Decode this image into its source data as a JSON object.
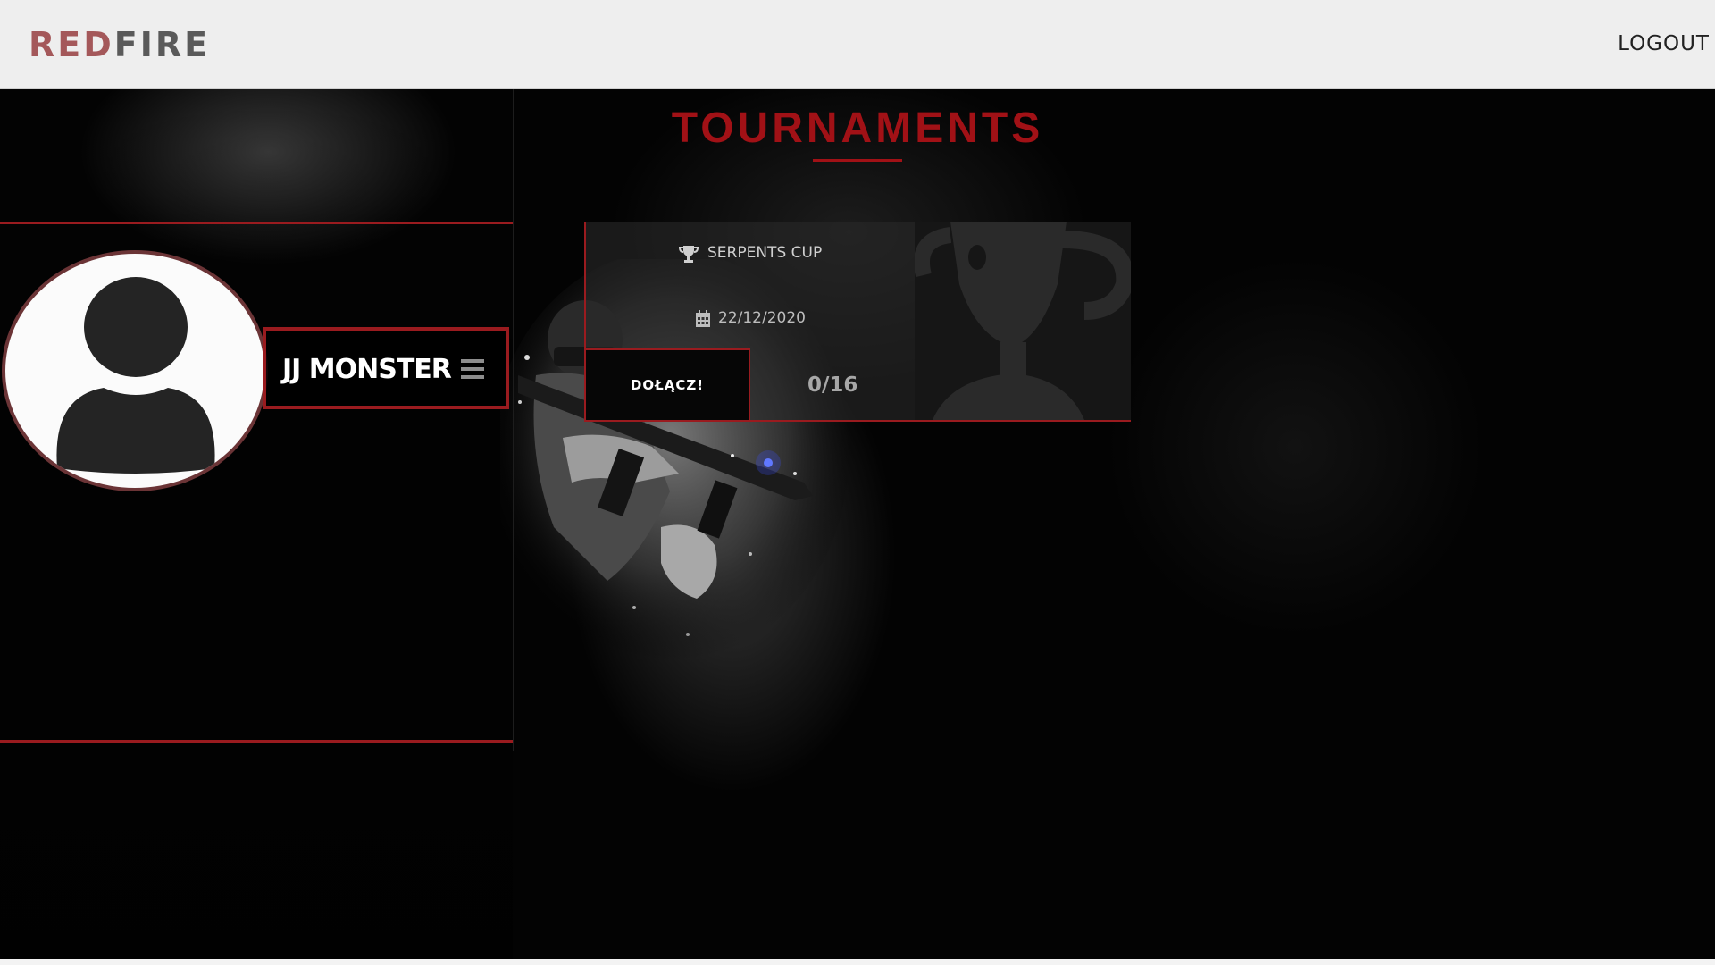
{
  "brand": {
    "part1": "RED",
    "part2": "FIRE"
  },
  "header": {
    "logout_label": "LOGOUT"
  },
  "page": {
    "title": "TOURNAMENTS"
  },
  "profile": {
    "username": "JJ MONSTER"
  },
  "tournament": {
    "name": "SERPENTS CUP",
    "date": "22/12/2020",
    "join_label": "DOŁĄCZ!",
    "slots": "0/16"
  },
  "colors": {
    "accent": "#9a1b1f",
    "title": "#a11116",
    "logo_red": "#a4585a",
    "logo_gray": "#5a5a5a",
    "topbar": "#eeeeee"
  },
  "icons": [
    "trophy-icon",
    "calendar-icon",
    "hamburger-menu-icon",
    "user-avatar-icon"
  ]
}
